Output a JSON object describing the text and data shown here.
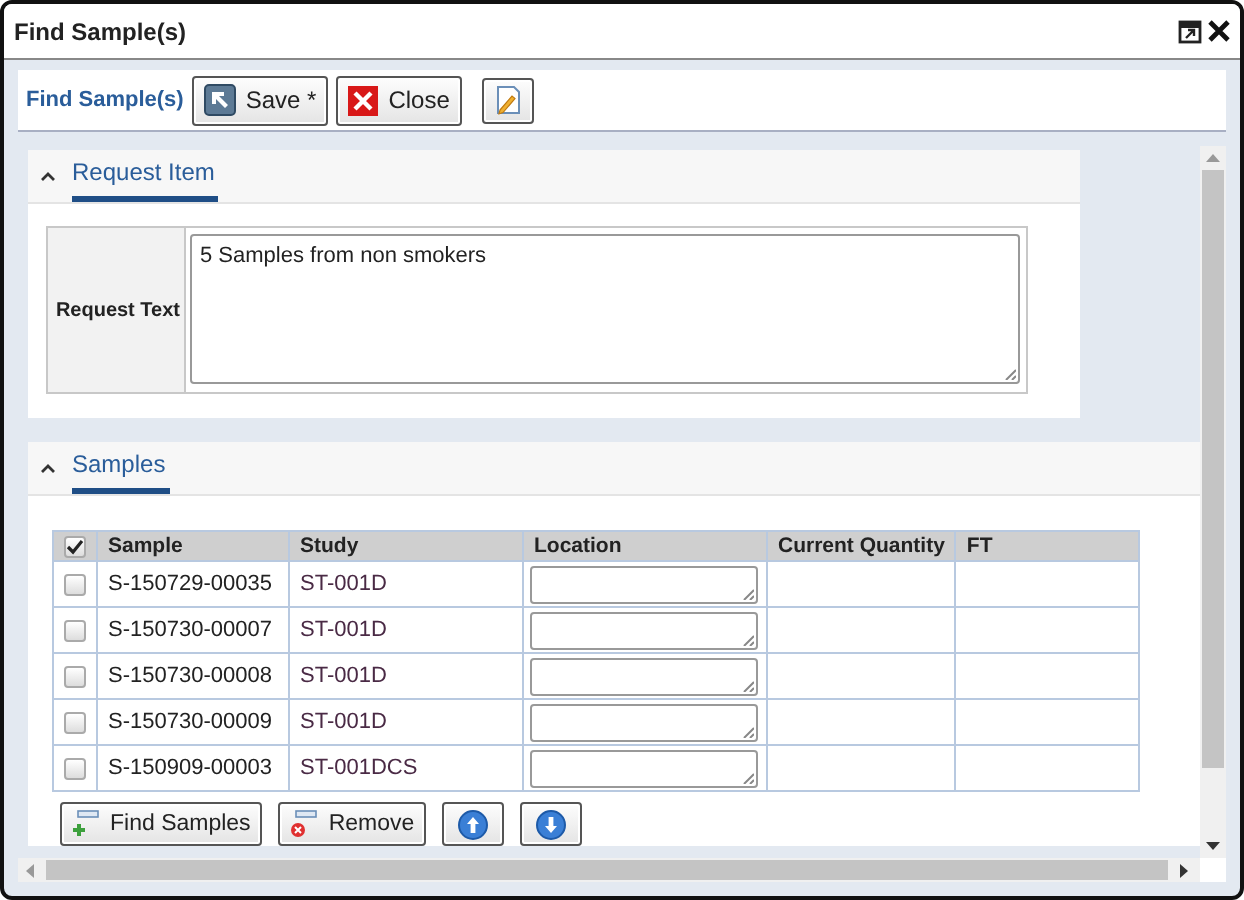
{
  "window": {
    "title": "Find Sample(s)"
  },
  "toolbar": {
    "title": "Find Sample(s)",
    "buttons": [
      {
        "kind": "save",
        "label": "Save *"
      },
      {
        "kind": "close",
        "label": "Close"
      },
      {
        "kind": "note"
      }
    ]
  },
  "request_item": {
    "heading": "Request Item",
    "expanded": true,
    "field_label": "Request Text",
    "value": "5 Samples from non smokers"
  },
  "samples": {
    "heading": "Samples",
    "expanded": true,
    "select_all_checked": true,
    "columns": [
      "Sample",
      "Study",
      "Location",
      "Current Quantity",
      "FT"
    ],
    "rows": [
      {
        "sample": "S-150729-00035",
        "study": "ST-001D",
        "checked": false
      },
      {
        "sample": "S-150730-00007",
        "study": "ST-001D",
        "checked": false
      },
      {
        "sample": "S-150730-00008",
        "study": "ST-001D",
        "checked": false
      },
      {
        "sample": "S-150730-00009",
        "study": "ST-001D",
        "checked": false
      },
      {
        "sample": "S-150909-00003",
        "study": "ST-001DCS",
        "checked": false
      }
    ],
    "buttons": [
      {
        "kind": "add",
        "label": "Find Samples"
      },
      {
        "kind": "remove",
        "label": "Remove"
      },
      {
        "kind": "up"
      },
      {
        "kind": "down"
      }
    ]
  }
}
